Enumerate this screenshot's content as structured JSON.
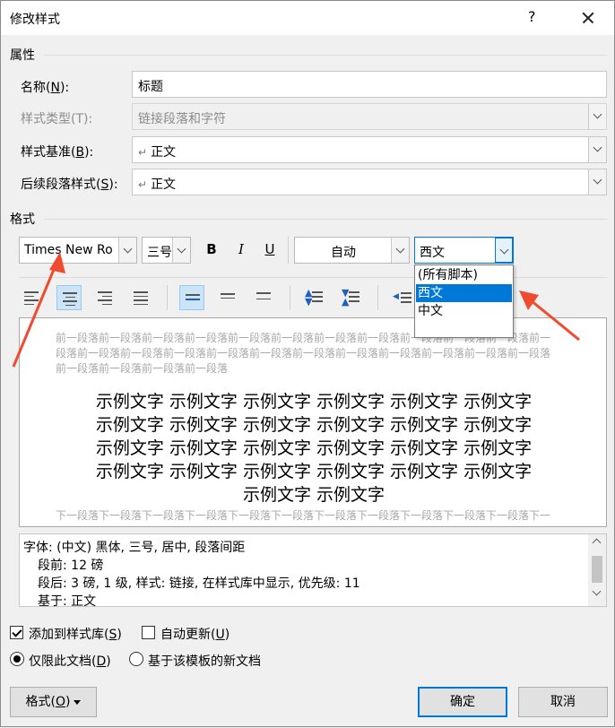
{
  "window": {
    "title": "修改样式",
    "help": "?"
  },
  "properties": {
    "section_label": "属性",
    "name": {
      "label": "名称(",
      "hotkey": "N",
      "label_end": "):",
      "value": "标题"
    },
    "style_type": {
      "label": "样式类型(T):",
      "value": "链接段落和字符"
    },
    "based_on": {
      "label": "样式基准(",
      "hotkey": "B",
      "label_end": "):",
      "value": "正文"
    },
    "next_style": {
      "label": "后续段落样式(",
      "hotkey": "S",
      "label_end": "):",
      "value": "正文"
    },
    "paragraph_mark": "↵"
  },
  "format": {
    "section_label": "格式",
    "font_name": "Times New Ro",
    "font_size": "三号",
    "bold": "B",
    "italic": "I",
    "underline": "U",
    "color": "自动",
    "script": "西文",
    "script_options": [
      "(所有脚本)",
      "西文",
      "中文"
    ],
    "script_selected_index": 1
  },
  "preview": {
    "prev_para": "前一段落前一段落前一段落前一段落前一段落前一段落前一段落前一段落前一段落前一段落前一段落前一段落前一段落前一段落前一段落前一段落前一段落前一段落前一段落前一段落前一段落前一段落前一段落前一段落前一段落前一段落前一段落",
    "sample_lines": [
      "示例文字 示例文字 示例文字 示例文字 示例文字 示例文字",
      "示例文字 示例文字 示例文字 示例文字 示例文字 示例文字",
      "示例文字 示例文字 示例文字 示例文字 示例文字 示例文字",
      "示例文字 示例文字 示例文字 示例文字 示例文字 示例文字",
      "示例文字 示例文字"
    ],
    "next_para": "下一段落下一段落下一段落下一段落下一段落下一段落下一段落下一段落下一段落下一段落下一段落下一段落下一段落下一段落下一段落下一段落下一段落下一段落下一段落下一段落下一段落下一段落下一段落下一段落下一段落下一段落下一段落"
  },
  "description": {
    "line1": "字体: (中文) 黑体, 三号, 居中, 段落间距",
    "line2": "段前: 12 磅",
    "line3": "段后: 3 磅, 1 级, 样式: 链接, 在样式库中显示, 优先级: 11",
    "line4": "基于: 正文"
  },
  "options": {
    "add_to_gallery": {
      "label": "添加到样式库(",
      "hotkey": "S",
      "label_end": ")",
      "checked": true
    },
    "auto_update": {
      "label": "自动更新(",
      "hotkey": "U",
      "label_end": ")",
      "checked": false
    },
    "this_doc_only": {
      "label": "仅限此文档(",
      "hotkey": "D",
      "label_end": ")",
      "checked": true
    },
    "new_docs_template": {
      "label": "基于该模板的新文档",
      "checked": false
    }
  },
  "buttons": {
    "format": {
      "label": "格式(",
      "hotkey": "O",
      "label_end": ")"
    },
    "ok": "确定",
    "cancel": "取消"
  },
  "colors": {
    "accent": "#0078d7",
    "annotation_arrow": "#f04a30"
  }
}
